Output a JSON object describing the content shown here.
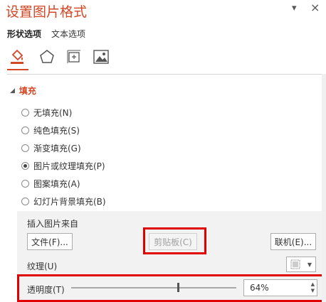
{
  "panel": {
    "title": "设置图片格式",
    "collapse_glyph": "▾",
    "close_glyph": "×"
  },
  "tabs": [
    {
      "label": "形状选项",
      "active": true
    },
    {
      "label": "文本选项",
      "active": false
    }
  ],
  "icons": [
    "fill-line-icon",
    "effects-pentagon-icon",
    "size-properties-icon",
    "picture-icon"
  ],
  "fill_section": {
    "label": "填充",
    "options": [
      {
        "label": "无填充(N)",
        "checked": false
      },
      {
        "label": "纯色填充(S)",
        "checked": false
      },
      {
        "label": "渐变填充(G)",
        "checked": false
      },
      {
        "label": "图片或纹理填充(P)",
        "checked": true
      },
      {
        "label": "图案填充(A)",
        "checked": false
      },
      {
        "label": "幻灯片背景填充(B)",
        "checked": false
      }
    ]
  },
  "insert": {
    "label": "插入图片来自",
    "file_button": "文件(F)...",
    "clipboard_button": "剪贴板(C)",
    "online_button": "联机(E)..."
  },
  "texture": {
    "label": "纹理(U)"
  },
  "transparency": {
    "label": "透明度(T)",
    "value": "64%",
    "fraction": 0.64
  },
  "colors": {
    "accent": "#d24726",
    "highlight": "#e00000"
  }
}
